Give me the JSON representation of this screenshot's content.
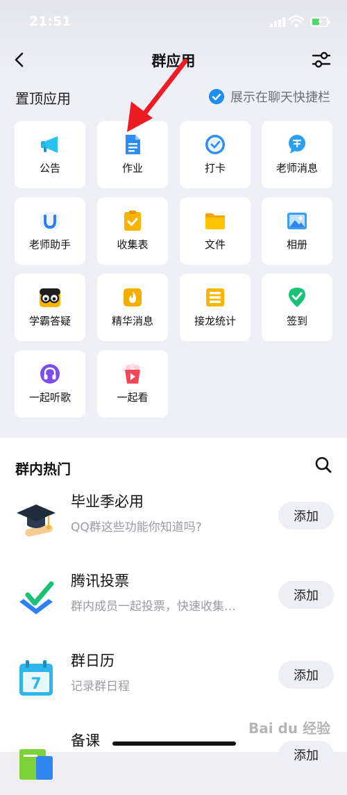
{
  "status": {
    "time": "21:51"
  },
  "nav": {
    "title": "群应用"
  },
  "pinned": {
    "label": "置顶应用",
    "shortcut_label": "展示在聊天快捷栏",
    "apps": [
      {
        "label": "公告",
        "icon": "megaphone-icon"
      },
      {
        "label": "作业",
        "icon": "homework-document-icon"
      },
      {
        "label": "打卡",
        "icon": "checkin-clock-icon"
      },
      {
        "label": "老师消息",
        "icon": "teacher-message-icon"
      },
      {
        "label": "老师助手",
        "icon": "teacher-assistant-icon"
      },
      {
        "label": "收集表",
        "icon": "collection-form-icon"
      },
      {
        "label": "文件",
        "icon": "folder-icon"
      },
      {
        "label": "相册",
        "icon": "photo-album-icon"
      },
      {
        "label": "学霸答疑",
        "icon": "qa-glasses-icon"
      },
      {
        "label": "精华消息",
        "icon": "highlight-message-icon"
      },
      {
        "label": "接龙统计",
        "icon": "list-stats-icon"
      },
      {
        "label": "签到",
        "icon": "sign-in-location-icon"
      },
      {
        "label": "一起听歌",
        "icon": "headphones-icon"
      },
      {
        "label": "一起看",
        "icon": "popcorn-video-icon"
      }
    ]
  },
  "hot": {
    "title": "群内热门",
    "items": [
      {
        "name": "毕业季必用",
        "desc": "QQ群这些功能你知道吗?",
        "add": "添加",
        "icon": "graduation-cap-icon"
      },
      {
        "name": "腾讯投票",
        "desc": "群内成员一起投票，快速收集…",
        "add": "添加",
        "icon": "vote-check-icon"
      },
      {
        "name": "群日历",
        "desc": "记录群日程",
        "add": "添加",
        "icon": "calendar-icon",
        "calendar_day": "7"
      },
      {
        "name": "备课",
        "desc": "",
        "add": "添加",
        "icon": "lesson-plan-icon"
      }
    ]
  },
  "watermark": "Bai du 经验"
}
